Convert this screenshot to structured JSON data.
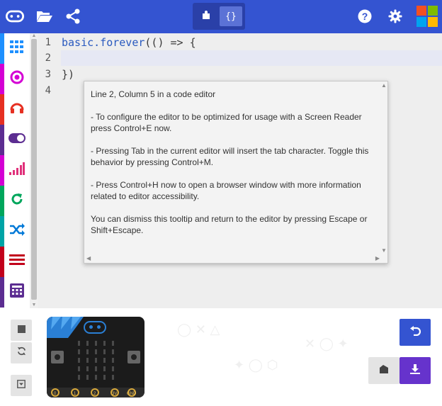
{
  "topbar": {
    "icons": [
      "microbit-logo-icon",
      "folder-open-icon",
      "share-icon",
      "help-icon",
      "settings-icon",
      "microsoft-logo-icon"
    ],
    "mode_toggle": {
      "blocks_icon": "puzzle-icon",
      "javascript_label": "{}"
    },
    "colors": {
      "bar": "#3454d1",
      "toggle_bg": "#2a40a8",
      "active": "#5b72d6"
    }
  },
  "toolbox": {
    "categories": [
      {
        "icon": "grid-icon",
        "color": "#1e90ff"
      },
      {
        "icon": "radio-target-icon",
        "color": "#d400d4"
      },
      {
        "icon": "headphones-icon",
        "color": "#e63022"
      },
      {
        "icon": "toggle-icon",
        "color": "#5c2d91"
      },
      {
        "icon": "signal-bars-icon",
        "color": "#d400d4"
      },
      {
        "icon": "loop-icon",
        "color": "#00a65c"
      },
      {
        "icon": "shuffle-icon",
        "color": "#00a4a6"
      },
      {
        "icon": "list-icon",
        "color": "#c2001b"
      },
      {
        "icon": "calculator-icon",
        "color": "#5c2d91"
      }
    ]
  },
  "editor": {
    "line_numbers": [
      "1",
      "2",
      "3",
      "4"
    ],
    "lines": [
      {
        "keyword": "basic.forever",
        "rest": "(() => {"
      },
      {
        "keyword": "",
        "rest": ""
      },
      {
        "keyword": "",
        "rest": "})"
      },
      {
        "keyword": "",
        "rest": ""
      }
    ]
  },
  "tooltip": {
    "paragraphs": [
      "Line 2, Column 5 in a code editor",
      "- To configure the editor to be optimized for usage with a Screen Reader press Control+E now.",
      "- Pressing Tab in the current editor will insert the tab character. Toggle this behavior by pressing Control+M.",
      "- Press Control+H now to open a browser window with more information related to editor accessibility.",
      "You can dismiss this tooltip and return to the editor by pressing Escape or Shift+Escape."
    ]
  },
  "simulator": {
    "controls": [
      "stop-icon",
      "restart-icon",
      "collapse-icon"
    ],
    "pins": [
      "0",
      "1",
      "2",
      "3V",
      "GND"
    ],
    "buttons": [
      "A",
      "B"
    ]
  },
  "actions": {
    "undo_icon": "undo-icon",
    "screenshot_icon": "camera-icon",
    "download_icon": "download-icon",
    "undo_color": "#3454d1",
    "download_color": "#6633cc"
  }
}
